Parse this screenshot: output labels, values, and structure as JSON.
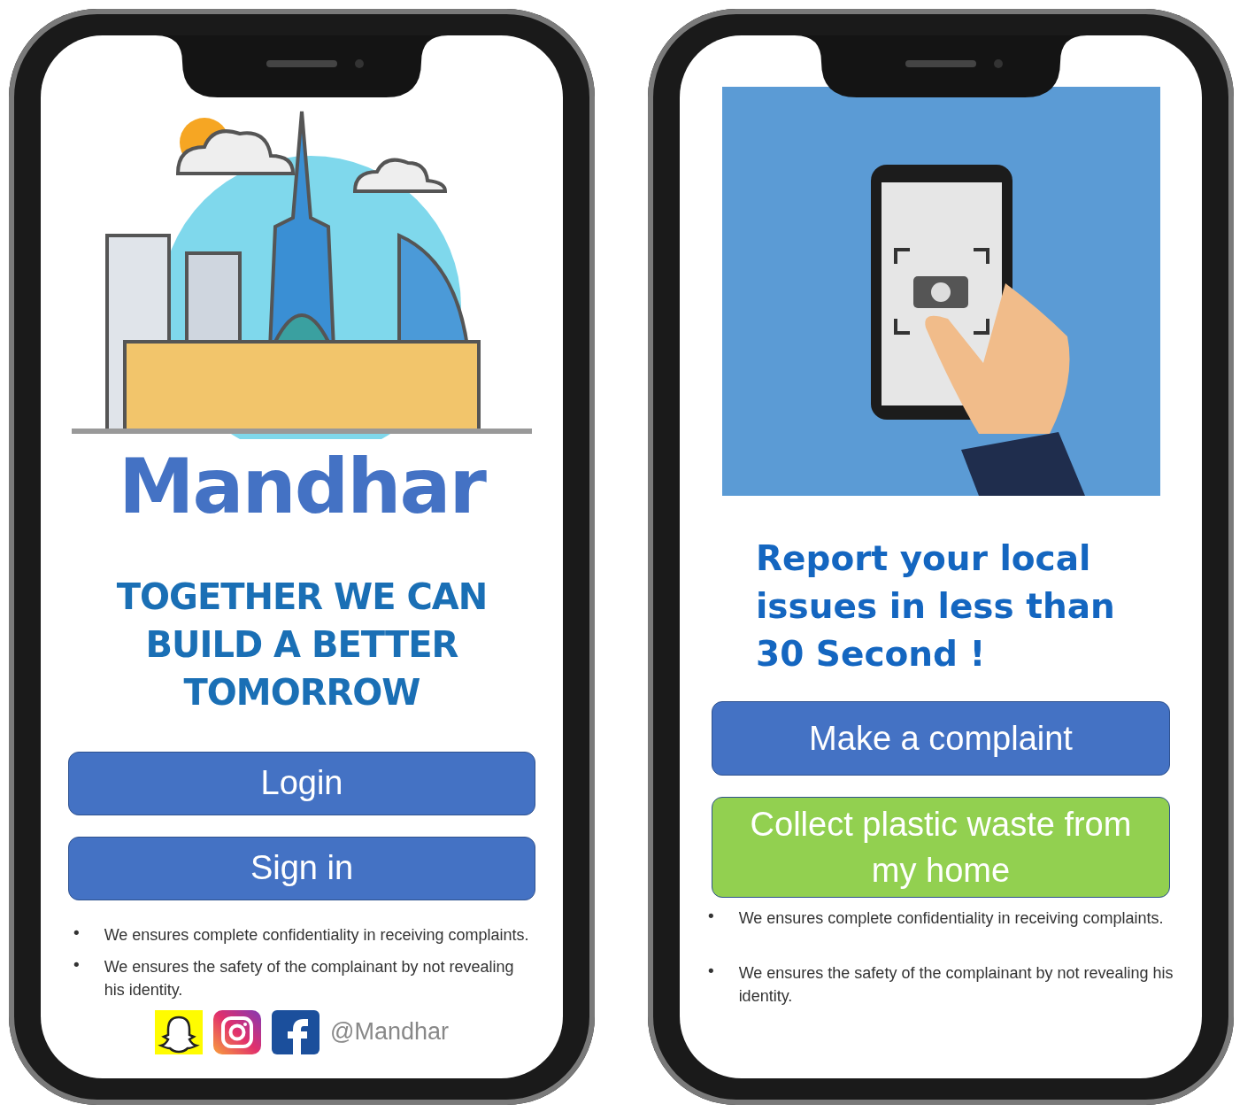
{
  "phones": [
    {
      "kind": "welcome",
      "title": "Mandhar",
      "tagline": "TOGETHER WE CAN BUILD A BETTER TOMORROW",
      "buttons": [
        {
          "label": "Login",
          "color": "#4472c4"
        },
        {
          "label": "Sign in",
          "color": "#4472c4"
        }
      ],
      "notes": [
        {
          "bullet": "•",
          "text": "We ensures complete confidentiality in receiving complaints."
        },
        {
          "bullet": "•",
          "text": "We ensures the safety of the complainant by not revealing his identity."
        }
      ],
      "social_handle": "@Mandhar"
    },
    {
      "kind": "report",
      "heading": "Report your local issues in less than 30 Second !",
      "buttons": [
        {
          "label": "Make a complaint",
          "color": "#4472c4"
        },
        {
          "label": "Collect plastic waste from my home",
          "color": "#92d050"
        }
      ],
      "notes": [
        {
          "bullet": "•",
          "text": "We ensures complete confidentiality in receiving complaints."
        },
        {
          "bullet": "•",
          "text": "We ensures the safety of the complainant by not revealing his identity."
        }
      ]
    }
  ]
}
